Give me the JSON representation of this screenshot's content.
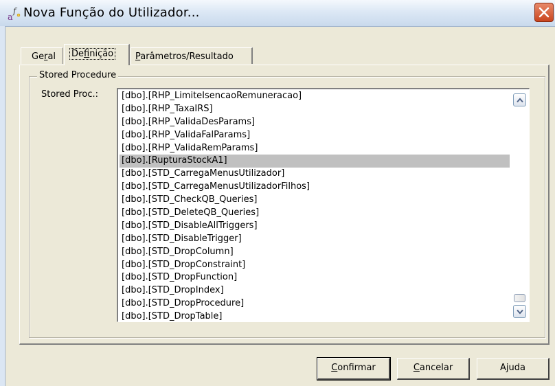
{
  "window": {
    "title": "Nova Função do Utilizador...",
    "icon": "function-icon",
    "close_icon": "close-icon"
  },
  "tabs": [
    {
      "label_pre": "Ge",
      "label_u": "r",
      "label_post": "al",
      "active": false
    },
    {
      "label_pre": "De",
      "label_u": "f",
      "label_post": "inição",
      "active": true
    },
    {
      "label_pre": "",
      "label_u": "P",
      "label_post": "arâmetros/Resultado",
      "active": false
    }
  ],
  "group": {
    "legend": "Stored Procedure",
    "field_label": "Stored Proc.:",
    "list_items": [
      "[dbo].[RHP_LimiteIsencaoRemuneracao]",
      "[dbo].[RHP_TaxaIRS]",
      "[dbo].[RHP_ValidaDesParams]",
      "[dbo].[RHP_ValidaFalParams]",
      "[dbo].[RHP_ValidaRemParams]",
      "[dbo].[RupturaStockA1]",
      "[dbo].[STD_CarregaMenusUtilizador]",
      "[dbo].[STD_CarregaMenusUtilizadorFilhos]",
      "[dbo].[STD_CheckQB_Queries]",
      "[dbo].[STD_DeleteQB_Queries]",
      "[dbo].[STD_DisableAllTriggers]",
      "[dbo].[STD_DisableTrigger]",
      "[dbo].[STD_DropColumn]",
      "[dbo].[STD_DropConstraint]",
      "[dbo].[STD_DropFunction]",
      "[dbo].[STD_DropIndex]",
      "[dbo].[STD_DropProcedure]",
      "[dbo].[STD_DropTable]"
    ],
    "selected_index": 5,
    "scroll_up_icon": "chevron-up-icon",
    "scroll_down_icon": "chevron-down-icon"
  },
  "buttons": {
    "confirmar": {
      "pre": "",
      "u": "C",
      "post": "onfirmar"
    },
    "cancelar": {
      "pre": "",
      "u": "C",
      "post": "ancelar"
    },
    "ajuda": {
      "pre": "A",
      "u": "j",
      "post": "uda"
    }
  },
  "colors": {
    "dialog_bg": "#ece9d8",
    "selection_bg": "#c0c0c0",
    "close_button": "#c9451f"
  }
}
